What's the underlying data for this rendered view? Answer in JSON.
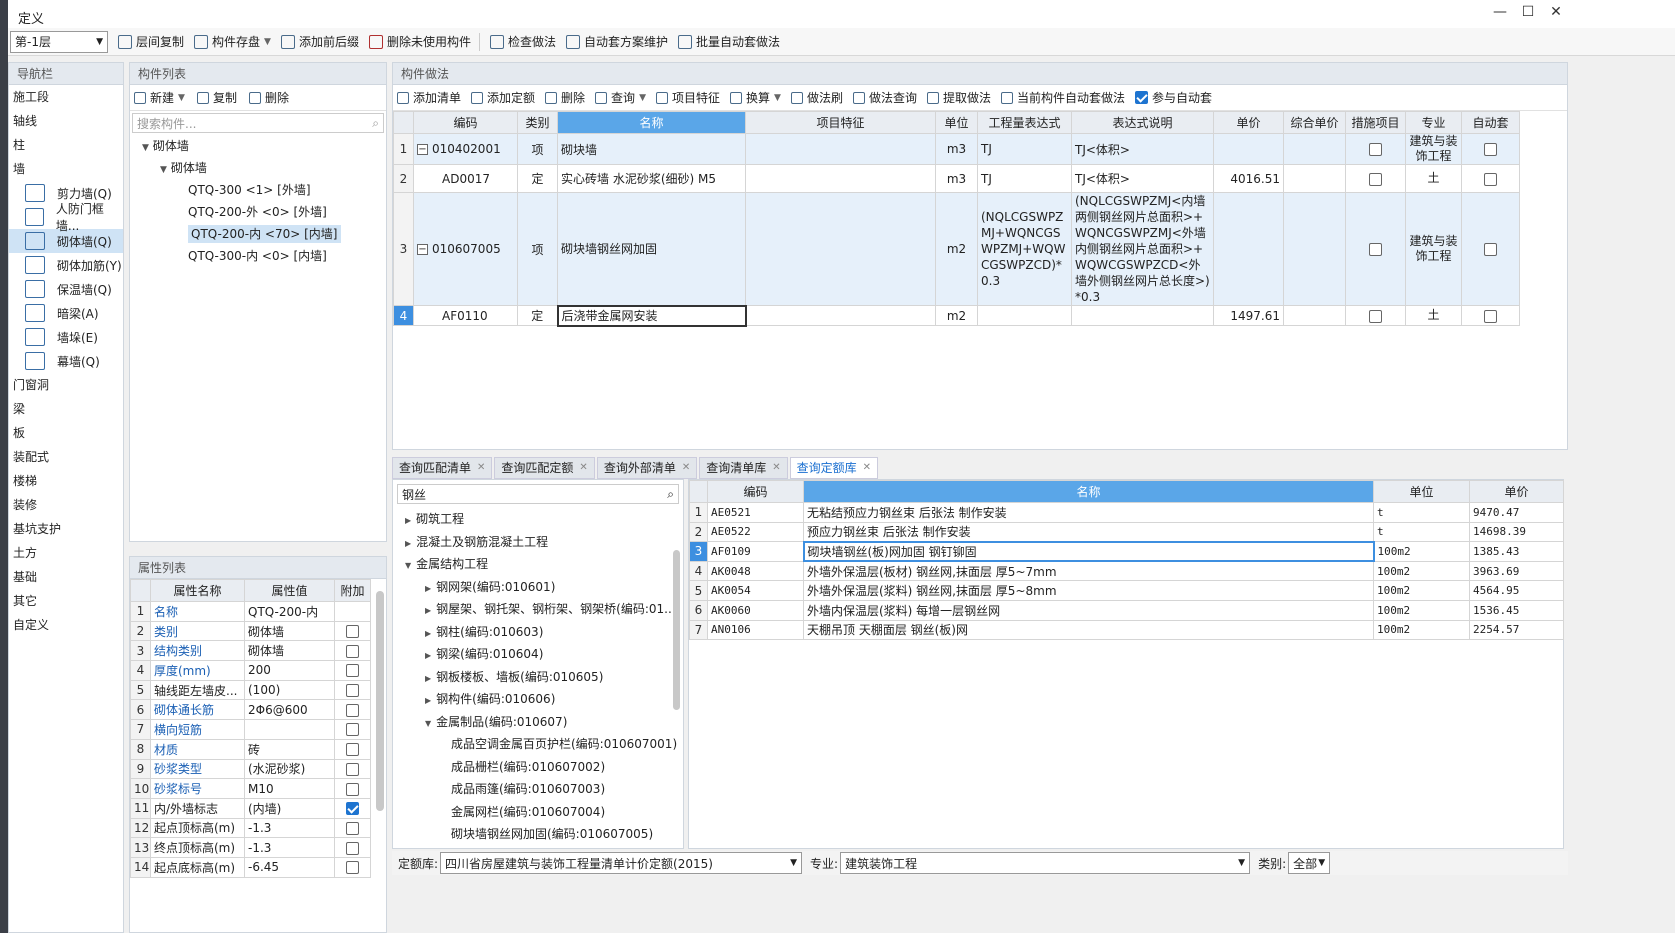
{
  "window": {
    "title": "定义"
  },
  "toolbar": {
    "floor": "第-1层",
    "items": [
      "层间复制",
      "构件存盘",
      "添加前后缀",
      "删除未使用构件",
      "检查做法",
      "自动套方案维护",
      "批量自动套做法"
    ]
  },
  "nav": {
    "title": "导航栏",
    "items": [
      "施工段",
      "轴线",
      "柱",
      "墙"
    ],
    "wall_subs": [
      "剪力墙(Q)",
      "人防门框墙...",
      "砌体墙(Q)",
      "砌体加筋(Y)",
      "保温墙(Q)",
      "暗梁(A)",
      "墙垛(E)",
      "幕墙(Q)"
    ],
    "items2": [
      "门窗洞",
      "梁",
      "板",
      "装配式",
      "楼梯",
      "装修",
      "基坑支护",
      "土方",
      "基础",
      "其它",
      "自定义"
    ]
  },
  "comp": {
    "title": "构件列表",
    "new": "新建",
    "copy": "复制",
    "delete": "删除",
    "search_ph": "搜索构件...",
    "tree": [
      "砌体墙",
      "砌体墙",
      "QTQ-300 <1> [外墙]",
      "QTQ-200-外 <0> [外墙]",
      "QTQ-200-内 <70> [内墙]",
      "QTQ-300-内 <0> [内墙]"
    ]
  },
  "props": {
    "title": "属性列表",
    "headers": [
      "属性名称",
      "属性值",
      "附加"
    ],
    "rows": [
      {
        "n": "1",
        "name": "名称",
        "val": "QTQ-200-内",
        "blue": true,
        "cb": ""
      },
      {
        "n": "2",
        "name": "类别",
        "val": "砌体墙",
        "blue": true,
        "cb": "off"
      },
      {
        "n": "3",
        "name": "结构类别",
        "val": "砌体墙",
        "blue": true,
        "cb": "off"
      },
      {
        "n": "4",
        "name": "厚度(mm)",
        "val": "200",
        "blue": true,
        "cb": "off"
      },
      {
        "n": "5",
        "name": "轴线距左墙皮...",
        "val": "(100)",
        "blue": false,
        "cb": "off"
      },
      {
        "n": "6",
        "name": "砌体通长筋",
        "val": "2Φ6@600",
        "blue": true,
        "cb": "off"
      },
      {
        "n": "7",
        "name": "横向短筋",
        "val": "",
        "blue": true,
        "cb": "off"
      },
      {
        "n": "8",
        "name": "材质",
        "val": "砖",
        "blue": true,
        "cb": "off"
      },
      {
        "n": "9",
        "name": "砂浆类型",
        "val": "(水泥砂浆)",
        "blue": true,
        "cb": "off"
      },
      {
        "n": "10",
        "name": "砂浆标号",
        "val": "M10",
        "blue": true,
        "cb": "off"
      },
      {
        "n": "11",
        "name": "内/外墙标志",
        "val": "(内墙)",
        "blue": false,
        "cb": "on"
      },
      {
        "n": "12",
        "name": "起点顶标高(m)",
        "val": "-1.3",
        "blue": false,
        "cb": "off"
      },
      {
        "n": "13",
        "name": "终点顶标高(m)",
        "val": "-1.3",
        "blue": false,
        "cb": "off"
      },
      {
        "n": "14",
        "name": "起点底标高(m)",
        "val": "-6.45",
        "blue": false,
        "cb": "off"
      }
    ]
  },
  "method": {
    "title": "构件做法",
    "tb": [
      "添加清单",
      "添加定额",
      "删除",
      "查询",
      "项目特征",
      "换算",
      "做法刷",
      "做法查询",
      "提取做法",
      "当前构件自动套做法",
      "参与自动套"
    ],
    "headers": [
      "编码",
      "类别",
      "名称",
      "项目特征",
      "单位",
      "工程量表达式",
      "表达式说明",
      "单价",
      "综合单价",
      "措施项目",
      "专业",
      "自动套"
    ],
    "rows": [
      {
        "n": "1",
        "code": "010402001",
        "type": "项",
        "name": "砌块墙",
        "unit": "m3",
        "expr": "TJ",
        "desc": "TJ<体积>",
        "price": "",
        "major": "建筑与装饰工程"
      },
      {
        "n": "2",
        "code": "AD0017",
        "type": "定",
        "name": "实心砖墙 水泥砂浆(细砂) M5",
        "unit": "m3",
        "expr": "TJ",
        "desc": "TJ<体积>",
        "price": "4016.51",
        "major": "土"
      },
      {
        "n": "3",
        "code": "010607005",
        "type": "项",
        "name": "砌块墙钢丝网加固",
        "unit": "m2",
        "expr": "(NQLCGSWPZMJ+WQNCGSWPZMJ+WQWCGSWPZCD)*0.3",
        "desc": "(NQLCGSWPZMJ<内墙两侧钢丝网片总面积>+WQNCGSWPZMJ<外墙内侧钢丝网片总面积>+WQWCGSWPZCD<外墙外侧钢丝网片总长度>)*0.3",
        "price": "",
        "major": "建筑与装饰工程"
      },
      {
        "n": "4",
        "code": "AF0110",
        "type": "定",
        "name": "后浇带金属网安装",
        "unit": "m2",
        "expr": "",
        "desc": "",
        "price": "1497.61",
        "major": "土"
      }
    ]
  },
  "query": {
    "tabs": [
      "查询匹配清单",
      "查询匹配定额",
      "查询外部清单",
      "查询清单库",
      "查询定额库"
    ],
    "search": "钢丝",
    "tree": [
      "砌筑工程",
      "混凝土及钢筋混凝土工程",
      "金属结构工程",
      "钢网架(编码:010601)",
      "钢屋架、钢托架、钢桁架、钢架桥(编码:01...",
      "钢柱(编码:010603)",
      "钢梁(编码:010604)",
      "钢板楼板、墙板(编码:010605)",
      "钢构件(编码:010606)",
      "金属制品(编码:010607)",
      "成品空调金属百页护栏(编码:010607001)",
      "成品栅栏(编码:010607002)",
      "成品雨篷(编码:010607003)",
      "金属网栏(编码:010607004)",
      "砌块墙钢丝网加固(编码:010607005)"
    ],
    "headers": [
      "编码",
      "名称",
      "单位",
      "单价"
    ],
    "rows": [
      {
        "n": "1",
        "code": "AE0521",
        "name": "无粘结预应力钢丝束 后张法 制作安装",
        "unit": "t",
        "price": "9470.47"
      },
      {
        "n": "2",
        "code": "AE0522",
        "name": "预应力钢丝束 后张法 制作安装",
        "unit": "t",
        "price": "14698.39"
      },
      {
        "n": "3",
        "code": "AF0109",
        "name": "砌块墙钢丝(板)网加固 钢钉铆固",
        "unit": "100m2",
        "price": "1385.43"
      },
      {
        "n": "4",
        "code": "AK0048",
        "name": "外墙外保温层(板材) 钢丝网,抹面层 厚5~7mm",
        "unit": "100m2",
        "price": "3963.69"
      },
      {
        "n": "5",
        "code": "AK0054",
        "name": "外墙外保温层(浆料) 钢丝网,抹面层 厚5~8mm",
        "unit": "100m2",
        "price": "4564.95"
      },
      {
        "n": "6",
        "code": "AK0060",
        "name": "外墙内保温层(浆料) 每增一层钢丝网",
        "unit": "100m2",
        "price": "1536.45"
      },
      {
        "n": "7",
        "code": "AN0106",
        "name": "天棚吊顶 天棚面层 钢丝(板)网",
        "unit": "100m2",
        "price": "2254.57"
      }
    ],
    "footer": {
      "lib_label": "定额库:",
      "lib": "四川省房屋建筑与装饰工程量清单计价定额(2015)",
      "major_label": "专业:",
      "major": "建筑装饰工程",
      "type_label": "类别:",
      "type": "全部"
    }
  }
}
